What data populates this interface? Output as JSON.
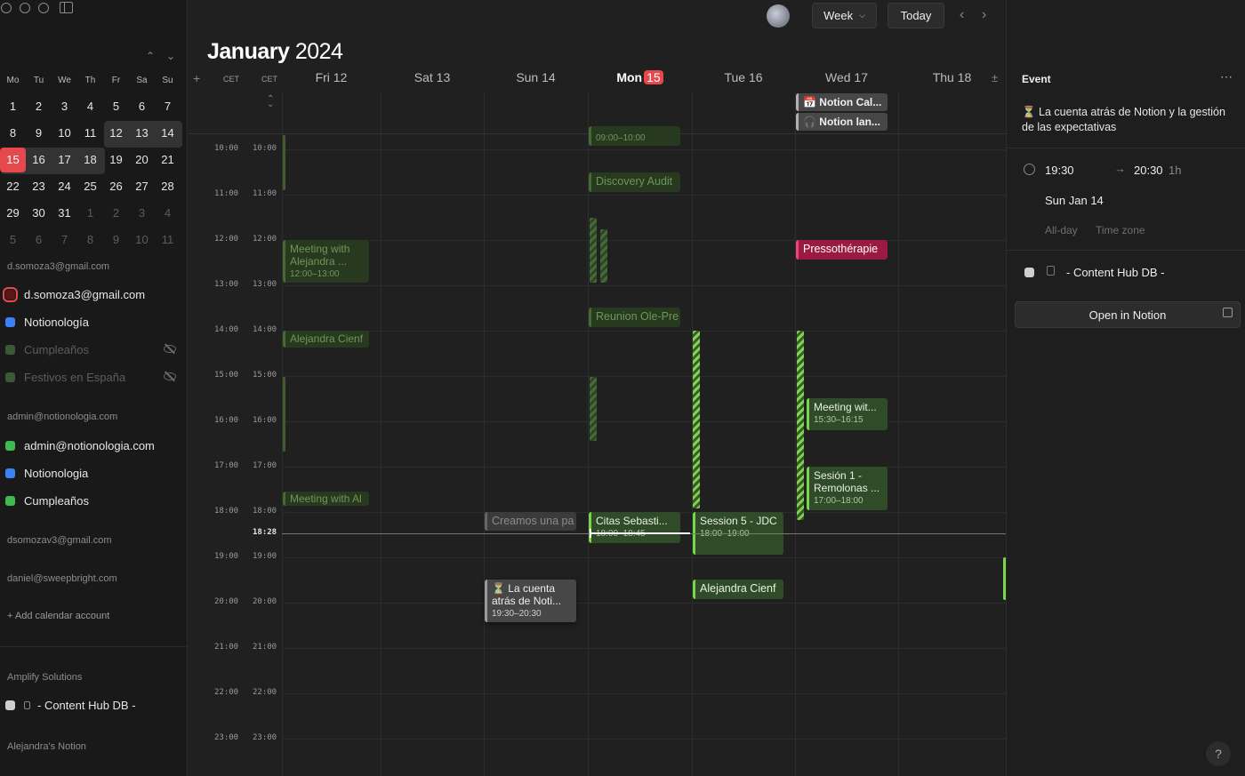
{
  "mini_calendar": {
    "weekdays": [
      "Mo",
      "Tu",
      "We",
      "Th",
      "Fr",
      "Sa",
      "Su"
    ],
    "weeks": [
      [
        "1",
        "2",
        "3",
        "4",
        "5",
        "6",
        "7"
      ],
      [
        "8",
        "9",
        "10",
        "11",
        "12",
        "13",
        "14"
      ],
      [
        "15",
        "16",
        "17",
        "18",
        "19",
        "20",
        "21"
      ],
      [
        "22",
        "23",
        "24",
        "25",
        "26",
        "27",
        "28"
      ],
      [
        "29",
        "30",
        "31",
        "1",
        "2",
        "3",
        "4"
      ],
      [
        "5",
        "6",
        "7",
        "8",
        "9",
        "10",
        "11"
      ]
    ],
    "today": "15"
  },
  "sidebar": {
    "groups": [
      {
        "email": "d.somoza3@gmail.com",
        "calendars": [
          {
            "label": "d.somoza3@gmail.com",
            "color": "#e5484d",
            "visible": true,
            "selected": true
          },
          {
            "label": "Notionología",
            "color": "#3b82f6",
            "visible": true
          },
          {
            "label": "Cumpleaños",
            "color": "#3a5a35",
            "visible": false
          },
          {
            "label": "Festivos en España",
            "color": "#3a5a35",
            "visible": false
          }
        ]
      },
      {
        "email": "admin@notionologia.com",
        "calendars": [
          {
            "label": "admin@notionologia.com",
            "color": "#3fb950",
            "visible": true
          },
          {
            "label": "Notionologia",
            "color": "#3b82f6",
            "visible": true
          },
          {
            "label": "Cumpleaños",
            "color": "#3fb950",
            "visible": true
          }
        ]
      },
      {
        "email": "dsomozav3@gmail.com",
        "calendars": []
      },
      {
        "email": "daniel@sweepbright.com",
        "calendars": []
      }
    ],
    "add_account": "+ Add calendar account",
    "workspace": "Amplify Solutions",
    "db_label": "- Content Hub DB -",
    "workspace2": "Alejandra's Notion"
  },
  "topbar": {
    "view": "Week",
    "today": "Today"
  },
  "calendar": {
    "month": "January",
    "year": "2024",
    "tz": [
      "CET",
      "CET"
    ],
    "days": [
      {
        "label": "Fri 12"
      },
      {
        "label": "Sat 13"
      },
      {
        "label": "Sun 14"
      },
      {
        "label": "Mon",
        "num": "15"
      },
      {
        "label": "Tue 16"
      },
      {
        "label": "Wed 17"
      },
      {
        "label": "Thu 18"
      }
    ],
    "hours": [
      "10:00",
      "11:00",
      "12:00",
      "13:00",
      "14:00",
      "15:00",
      "16:00",
      "17:00",
      "18:00",
      "19:00",
      "20:00",
      "21:00",
      "22:00",
      "23:00"
    ],
    "now": "18:28",
    "events": [
      {
        "id": "ev-notion-cal",
        "title": "📅 Notion Cal...",
        "style": "allday"
      },
      {
        "id": "ev-notion-lan",
        "title": "🎧 Notion lan...",
        "style": "allday"
      },
      {
        "id": "ev-mon-0900",
        "title": "",
        "sub": "09:00–10:00",
        "style": "dim"
      },
      {
        "id": "ev-discovery",
        "title": "Discovery Audit",
        "style": "dim"
      },
      {
        "id": "ev-meeting-alejandra",
        "title": "Meeting with Alejandra ...",
        "sub": "12:00–13:00",
        "style": "dim"
      },
      {
        "id": "ev-presso",
        "title": "Pressothérapie",
        "style": "pink"
      },
      {
        "id": "ev-alejandra-fri",
        "title": "Alejandra Cienf",
        "style": "dim"
      },
      {
        "id": "ev-reunion",
        "title": "Reunion Ole-Pre",
        "style": "dim"
      },
      {
        "id": "ev-meeting-wed",
        "title": "Meeting wit...",
        "sub": "15:30–16:15",
        "style": "br"
      },
      {
        "id": "ev-sesion",
        "title": "Sesión 1 - Remolonas ...",
        "sub": "17:00–18:00",
        "style": "br"
      },
      {
        "id": "ev-meeting-fri2",
        "title": "Meeting with Al",
        "style": "dim"
      },
      {
        "id": "ev-creamos",
        "title": "Creamos una pa",
        "style": "ghost"
      },
      {
        "id": "ev-citas",
        "title": "Citas Sebasti...",
        "sub": "18:00–18:45",
        "style": "br"
      },
      {
        "id": "ev-session5",
        "title": "Session 5 - JDC",
        "sub": "18:00–19:00",
        "style": "br"
      },
      {
        "id": "ev-cuenta",
        "title": "⏳ La cuenta atrás de Noti...",
        "sub": "19:30–20:30",
        "style": "gray"
      },
      {
        "id": "ev-alejandra-tue",
        "title": "Alejandra Cienf",
        "style": "br"
      }
    ]
  },
  "panel": {
    "header": "Event",
    "title": "⏳ La cuenta atrás de Notion y la gestión de las expectativas",
    "start": "19:30",
    "end": "20:30",
    "duration": "1h",
    "date": "Sun Jan 14",
    "all_day": "All-day",
    "time_zone": "Time zone",
    "calendar": "- Content Hub DB -",
    "open_btn": "Open in Notion",
    "help": "?"
  }
}
